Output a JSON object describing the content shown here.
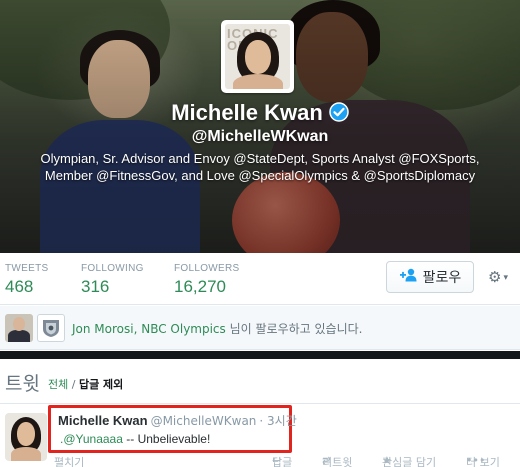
{
  "profile": {
    "name": "Michelle Kwan",
    "handle": "@MichelleWKwan",
    "bio_line1": "Olympian, Sr. Advisor and Envoy @StateDept, Sports Analyst @FOXSports,",
    "bio_line2": "Member @FitnessGov, and Love @SpecialOlympics & @SportsDiplomacy",
    "avatar_bg_text": "ICONIC ORE"
  },
  "stats": {
    "tweets_label": "TWEETS",
    "tweets_value": "468",
    "following_label": "FOLLOWING",
    "following_value": "316",
    "followers_label": "FOLLOWERS",
    "followers_value": "16,270"
  },
  "actions": {
    "follow_label": "팔로우",
    "follow_icon": "add-user-icon",
    "settings_icon": "gear-icon"
  },
  "followed_by": {
    "names": "Jon Morosi, NBC Olympics",
    "suffix": " 님이 팔로우하고 있습니다."
  },
  "tweets_section": {
    "title": "트윗",
    "tab_all": "전체",
    "separator": " / ",
    "tab_no_replies": "답글 제외"
  },
  "tweet": {
    "author": "Michelle Kwan",
    "handle": "@MichelleWKwan",
    "time": "· 3시간",
    "mention": ".@Yunaaaa",
    "text": " -- Unbelievable!",
    "expand": "펼치기",
    "reply": "답글",
    "retweet": "리트윗",
    "favorite": "관심글 담기",
    "more": "더 보기"
  },
  "colors": {
    "accent_green": "#2e8b57",
    "highlight_red": "#e2241e",
    "verified_blue": "#1da1f2"
  }
}
